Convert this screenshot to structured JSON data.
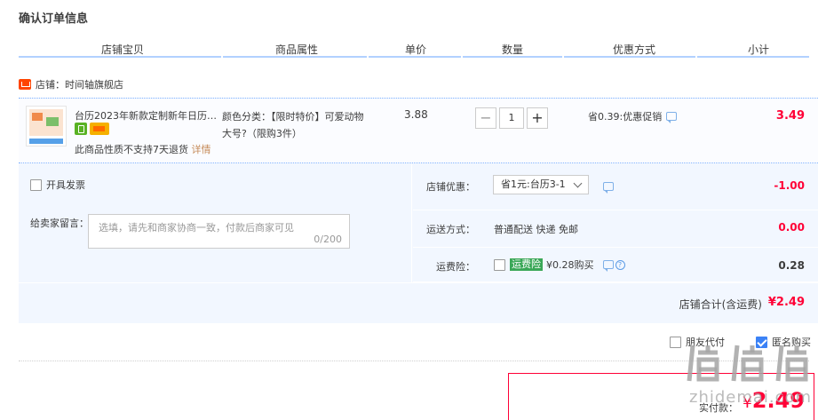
{
  "page": {
    "title": "确认订单信息"
  },
  "columns": [
    "店铺宝贝",
    "商品属性",
    "单价",
    "数量",
    "优惠方式",
    "小计"
  ],
  "shop": {
    "name": "店铺：时间轴旗舰店"
  },
  "item": {
    "title": "台历2023年新款定制新年日历…",
    "no_return": "此商品性质不支持7天退货",
    "detail_link": "详情",
    "prop_line1": "颜色分类：【限时特价】可爱动物",
    "prop_line2": "大号?（限购3件）",
    "price": "3.88",
    "qty_minus": "−",
    "qty": "1",
    "qty_plus": "+",
    "promo": "省0.39:优惠促销",
    "subtotal": "3.49"
  },
  "invoice": {
    "label": "开具发票",
    "checked": false
  },
  "message": {
    "label": "给卖家留言：",
    "placeholder": "选填，请先和商家协商一致，付款后商家可见",
    "count": "0/200"
  },
  "coupon": {
    "label": "店铺优惠：",
    "selected": "省1元:台历3-1",
    "value": "-1.00"
  },
  "shipping": {
    "label": "运送方式：",
    "text": "普通配送 快递 免邮",
    "value": "0.00"
  },
  "insurance": {
    "label": "运费险：",
    "tag": "运费险",
    "price": "¥0.28购买",
    "value": "0.28",
    "checked": false
  },
  "total": {
    "label": "店铺合计(含运费)",
    "value": "¥2.49"
  },
  "options": {
    "friend_pay": "朋友代付",
    "friend_pay_checked": false,
    "anonymous": "匿名购买",
    "anonymous_checked": true
  },
  "payment": {
    "label": "实付款：",
    "yen": "¥",
    "amount": "2.49"
  },
  "watermark": {
    "text": "zhidemai.com"
  },
  "colors": {
    "accent_red": "#ff0036",
    "line_blue": "#b2d1ff",
    "panel_bg": "#f2f7ff",
    "insurance_green": "#3aa757"
  }
}
